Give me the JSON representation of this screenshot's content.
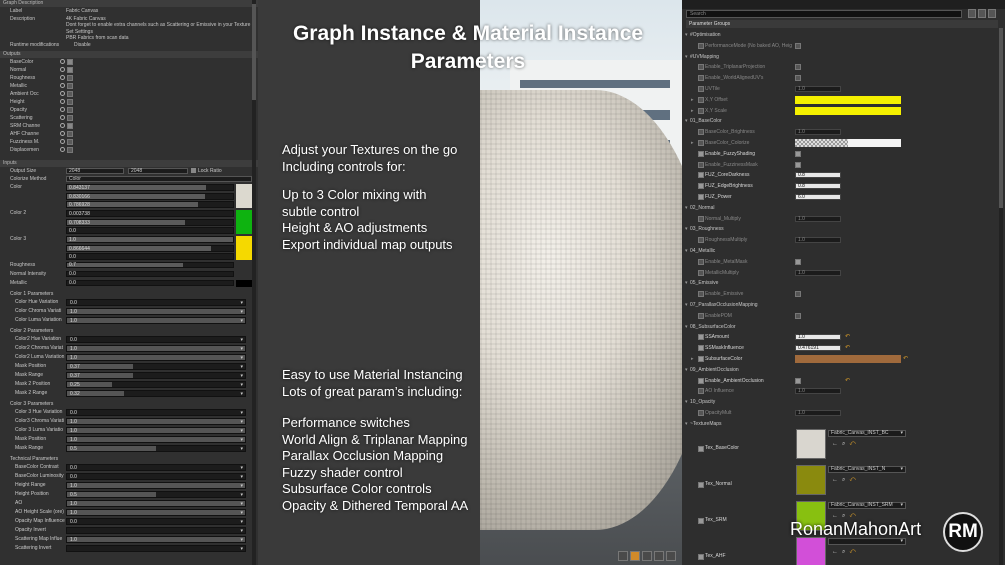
{
  "headline": [
    "Graph Instance & Material Instance",
    "Parameters"
  ],
  "blurb1": [
    "Adjust your Textures on the go",
    "Including controls for:"
  ],
  "blurb2": [
    "Up to 3 Color mixing with",
    "subtle control",
    "Height & AO adjustments",
    "Export individual map outputs"
  ],
  "blurb3": [
    "Easy to use Material Instancing",
    "Lots of great param’s including:"
  ],
  "blurb4": [
    "Performance switches",
    "World Align & Triplanar Mapping",
    "Parallax Occlusion Mapping",
    "Fuzzy shader control",
    "Subsurface Color controls",
    "Opacity & Dithered Temporal AA"
  ],
  "brand": {
    "name": "RonanMahonArt",
    "logo": "RM"
  },
  "left": {
    "graph_description_header": "Graph Description",
    "label_key": "Label",
    "label_val": "Fabric Canvas",
    "desc_key": "Description",
    "desc_lines": [
      "4K Fabric Canvas",
      "Dont forget to enable extra channels such as Scattering or Emissive in your Texture",
      "Set Settings",
      "PBR Fabrics from scan data"
    ],
    "runtime_key": "Runtime modifications",
    "runtime_val": "Disable",
    "outputs_header": "Outputs",
    "outputs": [
      {
        "name": "BaseColor",
        "on": true
      },
      {
        "name": "Normal",
        "on": true
      },
      {
        "name": "Roughness",
        "on": false
      },
      {
        "name": "Metallic",
        "on": false
      },
      {
        "name": "Ambient Occ",
        "on": false
      },
      {
        "name": "Height",
        "on": false
      },
      {
        "name": "Opacity",
        "on": false
      },
      {
        "name": "Scattering",
        "on": false
      },
      {
        "name": "SRM Channe",
        "on": true
      },
      {
        "name": "AHF Channe",
        "on": false
      },
      {
        "name": "Fuzziness M.",
        "on": false
      },
      {
        "name": "Displacemen",
        "on": false
      }
    ],
    "inputs_header": "Inputs",
    "output_size": {
      "label": "Output Size",
      "a": "2048",
      "b": "2048",
      "lock": "Lock Ratio"
    },
    "colorize": {
      "label": "Colorize Method",
      "val": "Color"
    },
    "color1": {
      "label": "Color",
      "vals": [
        "0.843137",
        "0.830166",
        "0.786928"
      ],
      "fills": [
        0.84,
        0.83,
        0.79
      ],
      "swatch": "#dcd9cf"
    },
    "color2": {
      "label": "Color 2",
      "vals": [
        "0.003738",
        "0.708333",
        "0.0"
      ],
      "fills": [
        0.0,
        0.71,
        0.0
      ],
      "swatch": "#0eb310"
    },
    "color3": {
      "label": "Color 3",
      "vals": [
        "1.0",
        "0.866644",
        "0.0"
      ],
      "fills": [
        1.0,
        0.87,
        0.0
      ],
      "swatch": "#f5d900"
    },
    "roughness": {
      "label": "Roughness",
      "val": "0.7",
      "fill": 0.7
    },
    "normal_intensity": {
      "label": "Normal Intensity",
      "val": "0.0",
      "fill": 0.0
    },
    "metallic": {
      "label": "Metallic",
      "val": "0.0",
      "fill": 0.0
    },
    "groups": [
      {
        "title": "Color 1 Parameters",
        "rows": [
          {
            "label": "Color Hue Variation",
            "val": "0.0",
            "fill": 0.0
          },
          {
            "label": "Color Chroma Variati",
            "val": "1.0",
            "fill": 1.0
          },
          {
            "label": "Color Luma Variation",
            "val": "1.0",
            "fill": 1.0
          }
        ]
      },
      {
        "title": "Color 2 Parameters",
        "rows": [
          {
            "label": "Color2 Hue Variation",
            "val": "0.0",
            "fill": 0.0
          },
          {
            "label": "Color2 Chroma Variat",
            "val": "1.0",
            "fill": 1.0
          },
          {
            "label": "Color2 Luma Variation",
            "val": "1.0",
            "fill": 1.0
          },
          {
            "label": "Mask Position",
            "val": "0.37",
            "fill": 0.37
          },
          {
            "label": "Mask Range",
            "val": "0.37",
            "fill": 0.37
          },
          {
            "label": "Mask 2 Position",
            "val": "0.25",
            "fill": 0.25
          },
          {
            "label": "Mask 2 Range",
            "val": "0.32",
            "fill": 0.32
          }
        ]
      },
      {
        "title": "Color 3 Parameters",
        "rows": [
          {
            "label": "Color 3 Hue Variation",
            "val": "0.0",
            "fill": 0.0
          },
          {
            "label": "Color3 Chroma Variati",
            "val": "1.0",
            "fill": 1.0
          },
          {
            "label": "Color 3 Luma Variatio",
            "val": "1.0",
            "fill": 1.0
          },
          {
            "label": "Mask Position",
            "val": "1.0",
            "fill": 1.0
          },
          {
            "label": "Mask Range",
            "val": "0.5",
            "fill": 0.5
          }
        ]
      },
      {
        "title": "Technical Parameters",
        "rows": [
          {
            "label": "BaseColor Contrast",
            "val": "0.0",
            "fill": 0.0
          },
          {
            "label": "BaseColor Luminosity",
            "val": "0.0",
            "fill": 0.0
          },
          {
            "label": "Height Range",
            "val": "1.0",
            "fill": 1.0
          },
          {
            "label": "Height Position",
            "val": "0.5",
            "fill": 0.5
          },
          {
            "label": "AO",
            "val": "1.0",
            "fill": 1.0
          },
          {
            "label": "AO Height Scale (ore)",
            "val": "1.0",
            "fill": 1.0
          },
          {
            "label": "Opacity Map Influence",
            "val": "0.0",
            "fill": 0.0
          },
          {
            "label": "Opacity Invert",
            "val": "",
            "fill": 0.0
          },
          {
            "label": "Scattering Map Influe",
            "val": "1.0",
            "fill": 1.0
          },
          {
            "label": "Scattering Invert",
            "val": "",
            "fill": 0.0
          }
        ]
      }
    ]
  },
  "right": {
    "search_placeholder": "Search",
    "header": "Parameter Groups",
    "rows": [
      {
        "t": "g",
        "label": "#Optimisation"
      },
      {
        "t": "b",
        "label": "PerformanceMode (No baked AO, Heig",
        "en": false,
        "on": false
      },
      {
        "t": "g",
        "label": "#UVMapping"
      },
      {
        "t": "b",
        "label": "Enable_TriplanarProjection",
        "en": false,
        "on": false
      },
      {
        "t": "b",
        "label": "Enable_WorldAlignedUV's",
        "en": false,
        "on": false
      },
      {
        "t": "f",
        "label": "UVTile",
        "en": false,
        "val": "1.0"
      },
      {
        "t": "c",
        "label": "X,Y Offset",
        "en": false,
        "color": "#f5f000"
      },
      {
        "t": "c",
        "label": "X,Y Scale",
        "en": false,
        "color": "#f5f000"
      },
      {
        "t": "g",
        "label": "01_BaseColor"
      },
      {
        "t": "f",
        "label": "BaseColor_Brightness",
        "en": false,
        "val": "1.0"
      },
      {
        "t": "c",
        "label": "BaseColor_Colorize",
        "en": false,
        "color": "checker"
      },
      {
        "t": "b",
        "label": "Enable_FuzzyShading",
        "en": true,
        "on": true
      },
      {
        "t": "b",
        "label": "Enable_FuzzinessMask",
        "en": false,
        "on": true
      },
      {
        "t": "f",
        "label": "FUZ_CoreDarkness",
        "en": true,
        "val": "0.8"
      },
      {
        "t": "f",
        "label": "FUZ_EdgeBrightness",
        "en": true,
        "val": "0.8"
      },
      {
        "t": "f",
        "label": "FUZ_Power",
        "en": true,
        "val": "6.0"
      },
      {
        "t": "g",
        "label": "02_Normal"
      },
      {
        "t": "f",
        "label": "Normal_Multiply",
        "en": false,
        "val": "1.0"
      },
      {
        "t": "g",
        "label": "03_Roughness"
      },
      {
        "t": "f",
        "label": "RoughnessMultiply",
        "en": false,
        "val": "1.0"
      },
      {
        "t": "g",
        "label": "04_Metallic"
      },
      {
        "t": "b",
        "label": "Enable_MetalMask",
        "en": false,
        "on": true
      },
      {
        "t": "f",
        "label": "MetallicMultiply",
        "en": false,
        "val": "1.0"
      },
      {
        "t": "g",
        "label": "05_Emissive"
      },
      {
        "t": "b",
        "label": "Enable_Emissive",
        "en": false,
        "on": false
      },
      {
        "t": "g",
        "label": "07_ParallaxOcclusionMapping"
      },
      {
        "t": "b",
        "label": "EnablePOM",
        "en": false,
        "on": false
      },
      {
        "t": "g",
        "label": "08_SubsurfaceColor"
      },
      {
        "t": "f",
        "label": "SSAmount",
        "en": true,
        "val": "1.0",
        "reset": true
      },
      {
        "t": "f",
        "label": "SSMaskInfluence",
        "en": true,
        "val": "0.476191",
        "reset": true
      },
      {
        "t": "c",
        "label": "SubsurfaceColor",
        "en": true,
        "color": "#a06a3c",
        "reset": true
      },
      {
        "t": "g",
        "label": "09_AmbientOcclusion"
      },
      {
        "t": "b",
        "label": "Enable_AmbientOcclusion",
        "en": true,
        "on": true,
        "reset": true
      },
      {
        "t": "f",
        "label": "AO Influence",
        "en": false,
        "val": "1.0"
      },
      {
        "t": "g",
        "label": "10_Opacity"
      },
      {
        "t": "f",
        "label": "OpacityMult",
        "en": false,
        "val": "1.0"
      },
      {
        "t": "g",
        "label": "~TextureMaps"
      }
    ],
    "textures": [
      {
        "label": "Tex_BaseColor",
        "asset": "Fabric_Canvas_INST_BC",
        "color": "#d9d6cf"
      },
      {
        "label": "Tex_Normal",
        "asset": "Fabric_Canvas_INST_N",
        "color": "#8a8a0e"
      },
      {
        "label": "Tex_SRM",
        "asset": "Fabric_Canvas_INST_SRM",
        "color": "#88c010"
      },
      {
        "label": "Tex_AHF",
        "asset": "",
        "color": "#d24fd8"
      }
    ]
  }
}
